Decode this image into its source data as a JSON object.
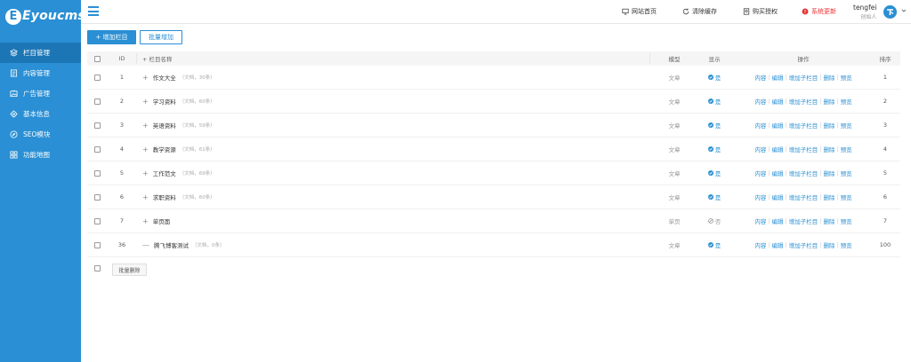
{
  "brand": {
    "logo_text": "Eyoucms"
  },
  "sidebar": {
    "items": [
      {
        "label": "栏目管理",
        "icon": "layers-icon",
        "active": true
      },
      {
        "label": "内容管理",
        "icon": "document-icon",
        "active": false
      },
      {
        "label": "广告管理",
        "icon": "image-icon",
        "active": false
      },
      {
        "label": "基本信息",
        "icon": "gear-icon",
        "active": false
      },
      {
        "label": "SEO模块",
        "icon": "compass-icon",
        "active": false
      },
      {
        "label": "功能地图",
        "icon": "grid-icon",
        "active": false
      }
    ]
  },
  "topbar": {
    "site_home": "网站首页",
    "clear_cache": "清除缓存",
    "buy_license": "购买授权",
    "system_update": "系统更新",
    "user_name": "tengfei",
    "user_role": "创始人"
  },
  "toolbar": {
    "add_label": "+ 增加栏目",
    "batch_add_label": "批量增加"
  },
  "table": {
    "headers": {
      "id": "ID",
      "name": "+ 栏目名称",
      "model": "模型",
      "show": "显示",
      "ops": "操作",
      "sort": "排序"
    },
    "op_labels": [
      "内容",
      "编辑",
      "增加子栏目",
      "删除",
      "预览"
    ],
    "rows": [
      {
        "id": "1",
        "prefix": "+",
        "name": "作文大全",
        "sub": "（文档，30条）",
        "model": "文章",
        "show": "是",
        "show_on": true,
        "sort": "1"
      },
      {
        "id": "2",
        "prefix": "+",
        "name": "学习资料",
        "sub": "（文档，60条）",
        "model": "文章",
        "show": "是",
        "show_on": true,
        "sort": "2"
      },
      {
        "id": "3",
        "prefix": "+",
        "name": "英语资料",
        "sub": "（文档，59条）",
        "model": "文章",
        "show": "是",
        "show_on": true,
        "sort": "3"
      },
      {
        "id": "4",
        "prefix": "+",
        "name": "教学资源",
        "sub": "（文档，61条）",
        "model": "文章",
        "show": "是",
        "show_on": true,
        "sort": "4"
      },
      {
        "id": "5",
        "prefix": "+",
        "name": "工作范文",
        "sub": "（文档，69条）",
        "model": "文章",
        "show": "是",
        "show_on": true,
        "sort": "5"
      },
      {
        "id": "6",
        "prefix": "+",
        "name": "求职资料",
        "sub": "（文档，60条）",
        "model": "文章",
        "show": "是",
        "show_on": true,
        "sort": "6"
      },
      {
        "id": "7",
        "prefix": "+",
        "name": "单页面",
        "sub": "",
        "model": "单页",
        "show": "否",
        "show_on": false,
        "sort": "7"
      },
      {
        "id": "36",
        "prefix": "—",
        "name": "腾飞博客测试",
        "sub": "（文档，0条）",
        "model": "文章",
        "show": "是",
        "show_on": true,
        "sort": "100"
      }
    ]
  },
  "footer": {
    "batch_delete_label": "批量删除"
  },
  "colors": {
    "accent": "#2a8fd4",
    "sidebar_bg": "#2a8fd4",
    "sidebar_active": "#1c76b6",
    "danger": "#e33333"
  }
}
